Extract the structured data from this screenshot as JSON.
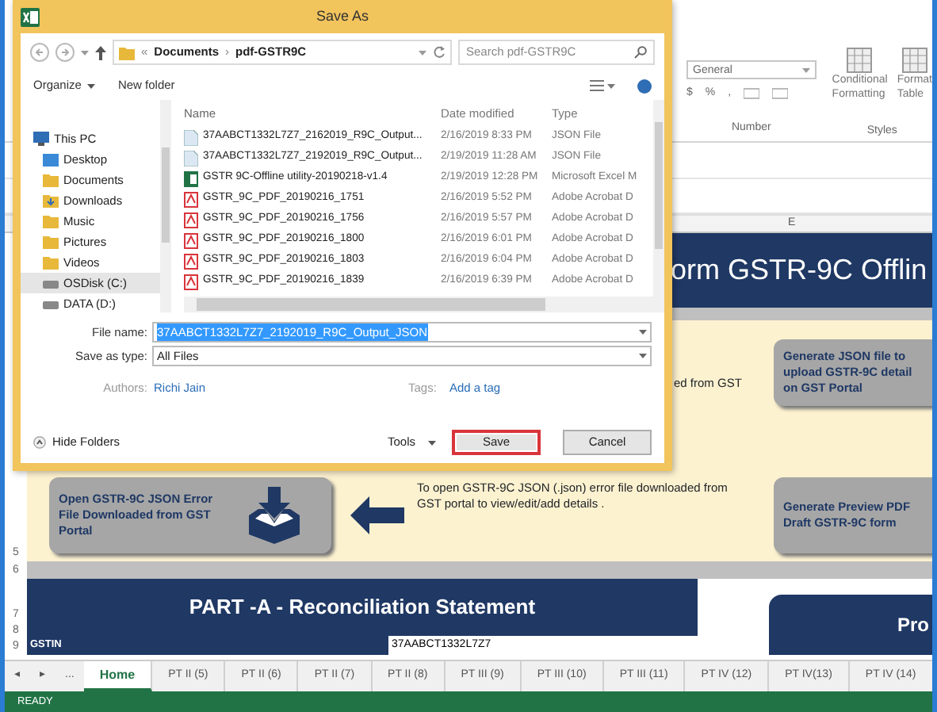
{
  "excel": {
    "ribbon": {
      "number_format": "General",
      "number_symbols": [
        "$",
        "%",
        ","
      ],
      "number_group": "Number",
      "style_buttons": [
        {
          "lines": [
            "Conditional",
            "Formatting"
          ]
        },
        {
          "lines": [
            "Format",
            "Table"
          ]
        }
      ],
      "styles_group": "Styles"
    },
    "column_header": "E",
    "banner_title": "orm GSTR-9C Offlin",
    "cut_text": "ed from GST",
    "generate_json_button": "Generate JSON file to upload GSTR-9C detail on GST Portal",
    "open_error_button": "Open GSTR-9C JSON Error File Downloaded from GST Portal",
    "open_error_hint": "To open GSTR-9C JSON (.json) error file downloaded from GST portal to view/edit/add details .",
    "preview_button": "Generate Preview PDF Draft GSTR-9C form",
    "row_numbers": [
      "5",
      "6",
      "7",
      "8",
      "9"
    ],
    "part_a_title": "PART -A - Reconciliation Statement",
    "gstin_label": "GSTIN",
    "gstin_value": "37AABCT1332L7Z7",
    "side_title": "Pro",
    "tab_nav": [
      "◂",
      "▸",
      "..."
    ],
    "sheet_tabs": [
      {
        "label": "Home",
        "selected": true
      },
      {
        "label": "PT II (5)",
        "selected": false
      },
      {
        "label": "PT II (6)",
        "selected": false
      },
      {
        "label": "PT II (7)",
        "selected": false
      },
      {
        "label": "PT II (8)",
        "selected": false
      },
      {
        "label": "PT III (9)",
        "selected": false
      },
      {
        "label": "PT III (10)",
        "selected": false
      },
      {
        "label": "PT III (11)",
        "selected": false
      },
      {
        "label": "PT IV (12)",
        "selected": false
      },
      {
        "label": "PT IV(13)",
        "selected": false
      },
      {
        "label": "PT IV (14)",
        "selected": false
      }
    ],
    "status": "READY"
  },
  "dialog": {
    "title": "Save As",
    "path": [
      "«",
      "Documents",
      "›",
      "pdf-GSTR9C"
    ],
    "search_placeholder": "Search pdf-GSTR9C",
    "toolbar": [
      "Organize",
      "New folder"
    ],
    "sidebar": [
      {
        "label": "This PC",
        "kind": "pc",
        "selected": false,
        "children": [
          {
            "label": "Desktop",
            "kind": "desktop",
            "selected": false
          },
          {
            "label": "Documents",
            "kind": "folder",
            "selected": false
          },
          {
            "label": "Downloads",
            "kind": "download",
            "selected": false
          },
          {
            "label": "Music",
            "kind": "folder",
            "selected": false
          },
          {
            "label": "Pictures",
            "kind": "folder",
            "selected": false
          },
          {
            "label": "Videos",
            "kind": "folder",
            "selected": false
          },
          {
            "label": "OSDisk (C:)",
            "kind": "drive",
            "selected": true
          },
          {
            "label": "DATA (D:)",
            "kind": "drive",
            "selected": false
          }
        ]
      }
    ],
    "columns": [
      "Name",
      "Date modified",
      "Type"
    ],
    "files": [
      {
        "kind": "json",
        "name": "37AABCT1332L7Z7_2162019_R9C_Output...",
        "date": "2/16/2019 8:33 PM",
        "type": "JSON File"
      },
      {
        "kind": "json",
        "name": "37AABCT1332L7Z7_2192019_R9C_Output...",
        "date": "2/19/2019 11:28 AM",
        "type": "JSON File"
      },
      {
        "kind": "excel",
        "name": "GSTR 9C-Offline utility-20190218-v1.4",
        "date": "2/19/2019 12:28 PM",
        "type": "Microsoft Excel M"
      },
      {
        "kind": "pdf",
        "name": "GSTR_9C_PDF_20190216_1751",
        "date": "2/16/2019 5:52 PM",
        "type": "Adobe Acrobat D"
      },
      {
        "kind": "pdf",
        "name": "GSTR_9C_PDF_20190216_1756",
        "date": "2/16/2019 5:57 PM",
        "type": "Adobe Acrobat D"
      },
      {
        "kind": "pdf",
        "name": "GSTR_9C_PDF_20190216_1800",
        "date": "2/16/2019 6:01 PM",
        "type": "Adobe Acrobat D"
      },
      {
        "kind": "pdf",
        "name": "GSTR_9C_PDF_20190216_1803",
        "date": "2/16/2019 6:04 PM",
        "type": "Adobe Acrobat D"
      },
      {
        "kind": "pdf",
        "name": "GSTR_9C_PDF_20190216_1839",
        "date": "2/16/2019 6:39 PM",
        "type": "Adobe Acrobat D"
      }
    ],
    "file_name_label": "File name:",
    "file_name": "37AABCT1332L7Z7_2192019_R9C_Output_JSON",
    "file_name_selected": true,
    "save_type_label": "Save as type:",
    "save_type": "All Files",
    "authors_label": "Authors:",
    "author": "Richi Jain",
    "tags_label": "Tags:",
    "tags": "Add a tag",
    "hide_folders": "Hide Folders",
    "tools": "Tools",
    "buttons": [
      {
        "label": "Save",
        "highlighted": true
      },
      {
        "label": "Cancel",
        "highlighted": false
      }
    ]
  }
}
